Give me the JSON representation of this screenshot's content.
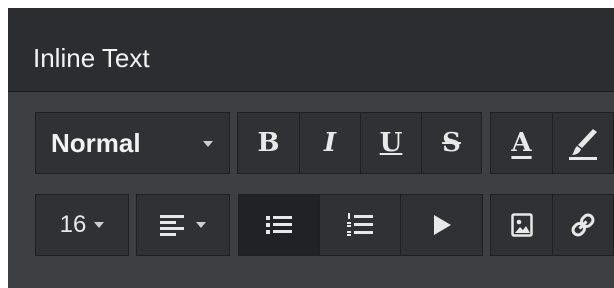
{
  "panel": {
    "title": "Inline Text"
  },
  "toolbar": {
    "format_select": {
      "value": "Normal"
    },
    "bold": {
      "label": "B"
    },
    "italic": {
      "label": "I"
    },
    "underline": {
      "label": "U"
    },
    "strikethrough": {
      "label": "S"
    },
    "font_color": {
      "label": "A"
    },
    "highlight": {
      "icon": "paintbrush-icon"
    },
    "font_size": {
      "value": "16"
    },
    "align": {
      "icon": "align-left-icon"
    },
    "unordered_list": {
      "icon": "bullet-list-icon",
      "active": true
    },
    "ordered_list": {
      "icon": "numbered-list-icon"
    },
    "play": {
      "icon": "play-icon"
    },
    "image": {
      "icon": "image-icon"
    },
    "link": {
      "icon": "link-icon"
    }
  },
  "colors": {
    "header_bg": "#2b2d30",
    "panel_bg": "#3d3f43",
    "button_bg": "#2f3134",
    "active_bg": "#212225",
    "text": "#e8e8e8"
  }
}
